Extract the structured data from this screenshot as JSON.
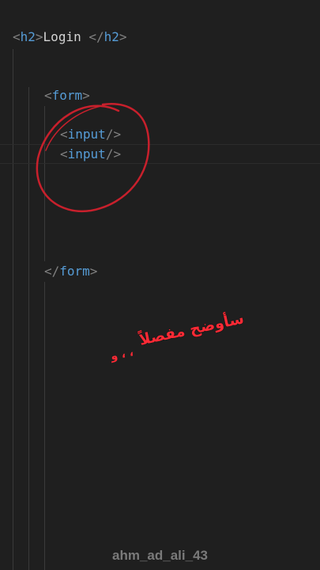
{
  "editor": {
    "line1": {
      "open": "<",
      "tag": "h2",
      "mid": ">",
      "text": "Login ",
      "close_open": "</",
      "close_tag": "h2",
      "close_end": ">"
    },
    "line2": {
      "open": "<",
      "tag": "form",
      "end": ">"
    },
    "line3": {
      "open": "<",
      "tag": "input",
      "end": "/>"
    },
    "line4": {
      "open": "<",
      "tag": "input",
      "end": "/>"
    },
    "line5": {
      "open": "</",
      "tag": "form",
      "end": ">"
    }
  },
  "overlay": {
    "caption": "سأوضح مفصلاً",
    "caption_small": "و ، ،",
    "circle_color": "#c8202c",
    "caption_color": "#ff2a35"
  },
  "watermark": "ahm_ad_ali_43"
}
